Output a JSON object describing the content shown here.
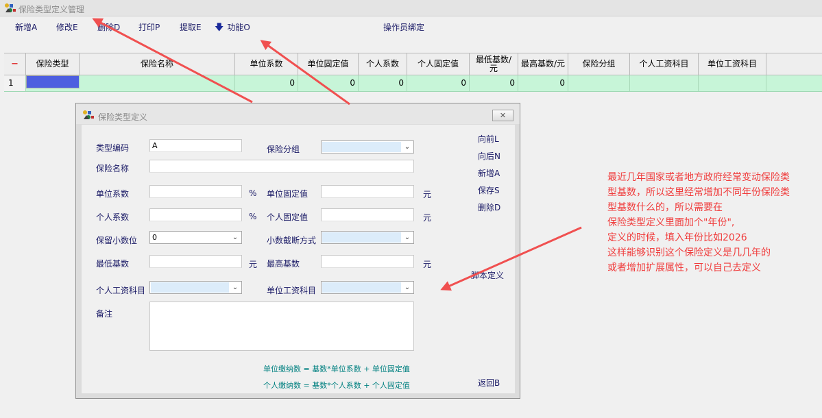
{
  "window": {
    "title": "保险类型定义管理"
  },
  "toolbar": {
    "new": "新增A",
    "edit": "修改E",
    "delete": "删除D",
    "print": "打印P",
    "extract": "提取E",
    "function": "功能O",
    "operator_bind": "操作员绑定"
  },
  "grid": {
    "headers": {
      "marker": "−",
      "type": "保险类型",
      "name": "保险名称",
      "unit_coef": "单位系数",
      "unit_fixed": "单位固定值",
      "person_coef": "个人系数",
      "person_fixed": "个人固定值",
      "min_base": "最低基数/元",
      "max_base": "最高基数/元",
      "group": "保险分组",
      "person_item": "个人工资科目",
      "unit_item": "单位工资科目"
    },
    "row": {
      "no": "1",
      "type": "",
      "name": "",
      "unit_coef": "0",
      "unit_fixed": "0",
      "person_coef": "0",
      "person_fixed": "0",
      "min_base": "0",
      "max_base": "0",
      "group": "",
      "person_item": "",
      "unit_item": ""
    }
  },
  "dialog": {
    "title": "保险类型定义",
    "close": "✕",
    "labels": {
      "type_code": "类型编码",
      "insurance_group": "保险分组",
      "insurance_name": "保险名称",
      "unit_coef": "单位系数",
      "unit_fixed": "单位固定值",
      "person_coef": "个人系数",
      "person_fixed": "个人固定值",
      "decimals": "保留小数位",
      "truncate": "小数截断方式",
      "min_base": "最低基数",
      "max_base": "最高基数",
      "person_item": "个人工资科目",
      "unit_item": "单位工资科目",
      "remark": "备注"
    },
    "values": {
      "type_code": "A",
      "decimals": "0"
    },
    "units": {
      "percent": "%",
      "yuan": "元"
    },
    "side": {
      "prev": "向前L",
      "next": "向后N",
      "new": "新增A",
      "save": "保存S",
      "delete": "删除D",
      "script": "脚本定义",
      "back": "返回B"
    },
    "formula_unit": "单位缴纳数 = 基数*单位系数 + 单位固定值",
    "formula_person": "个人缴纳数 = 基数*个人系数 + 个人固定值"
  },
  "annotation": {
    "lines": [
      "最近几年国家或者地方政府经常变动保险类",
      "型基数，所以这里经常增加不同年份保险类",
      "型基数什么的，所以需要在",
      "保险类型定义里面加个\"年份\",",
      "定义的时候，填入年份比如2026",
      "这样能够识别这个保险定义是几几年的",
      "或者增加扩展属性，可以自己去定义"
    ]
  },
  "colors": {
    "grid_row": "#c7f5d8",
    "selected_cell": "#4d5fe0",
    "annotation": "#f03c3c",
    "formula": "#008080"
  },
  "icons": [
    "app-icon",
    "close-icon",
    "down-arrow-icon",
    "chevron-down-icon"
  ]
}
